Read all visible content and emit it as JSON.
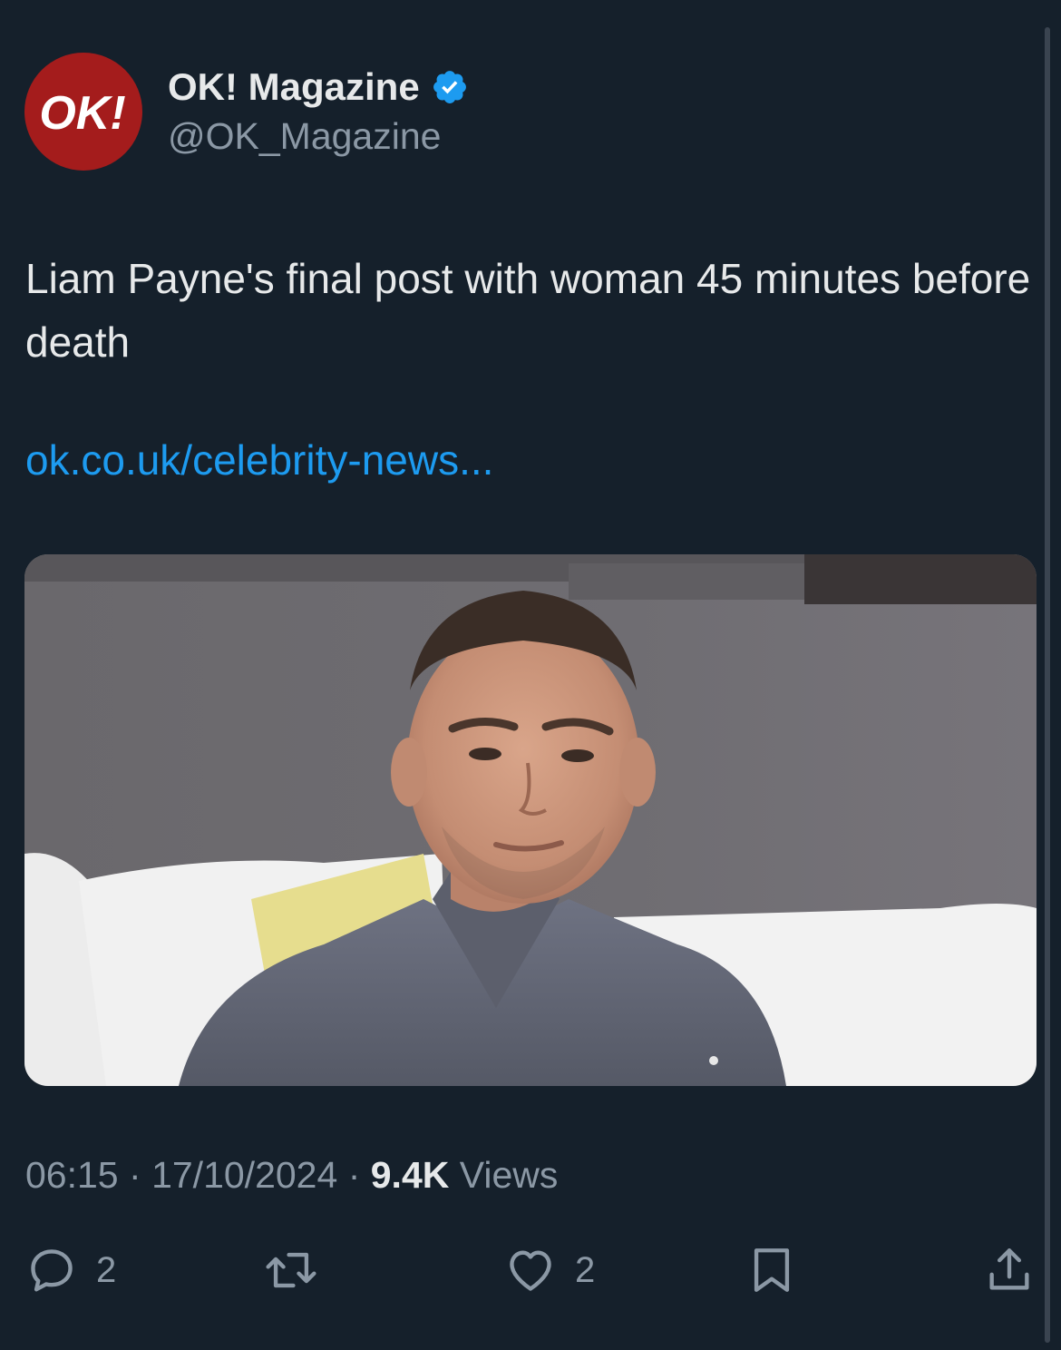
{
  "author": {
    "avatar_text": "OK!",
    "display_name": "OK! Magazine",
    "handle": "@OK_Magazine",
    "verified": true
  },
  "tweet": {
    "text": "Liam Payne's final post with woman 45 minutes before death",
    "link": "ok.co.uk/celebrity-news...",
    "media_icon": "photo-of-man-in-grey-suit"
  },
  "meta": {
    "time": "06:15",
    "separator": "·",
    "date": "17/10/2024",
    "views_count": "9.4K",
    "views_label": "Views"
  },
  "actions": {
    "reply_count": "2",
    "like_count": "2"
  },
  "colors": {
    "background": "#15202b",
    "link": "#1d9bf0",
    "secondary_text": "#8b98a5",
    "avatar_red": "#a41c1c"
  }
}
